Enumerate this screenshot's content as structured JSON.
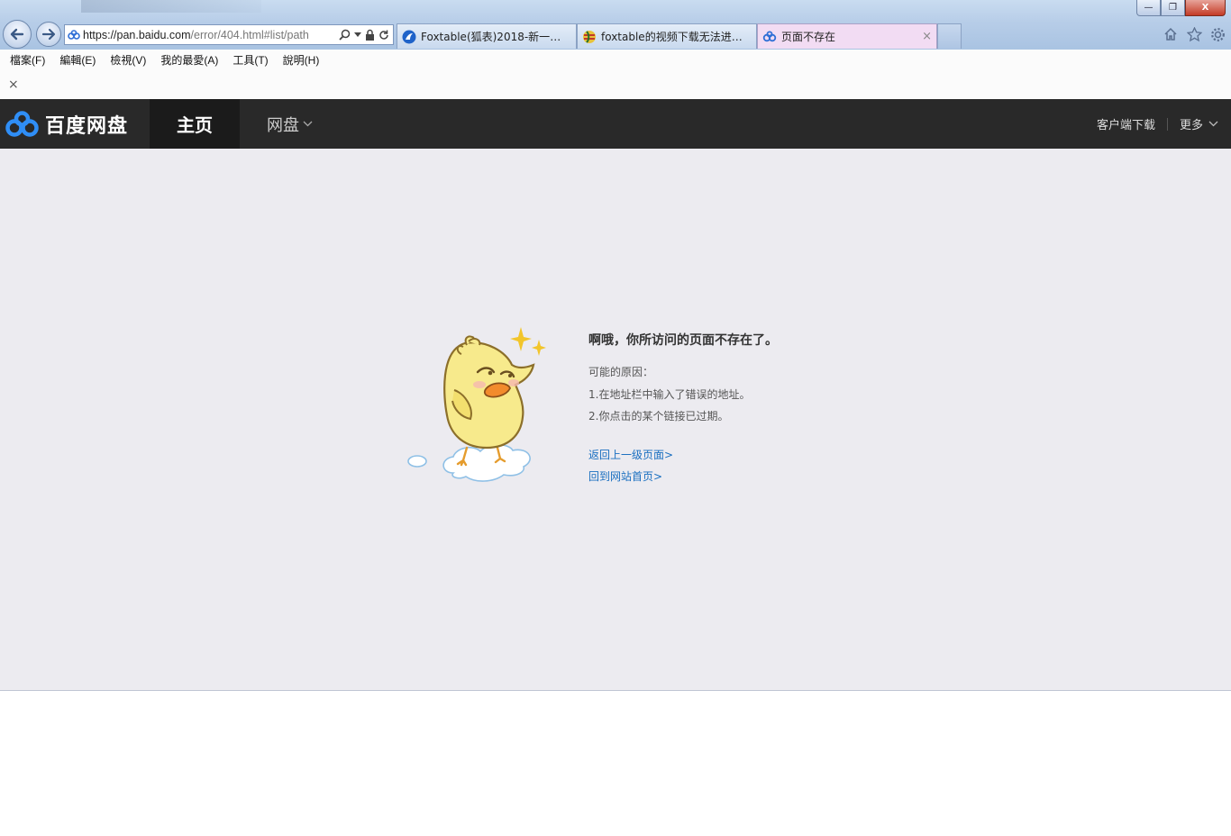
{
  "browser": {
    "address": {
      "url_main": "https://pan.baidu.com",
      "url_path": "/error/404.html#list/path"
    },
    "tabs": [
      {
        "label": "Foxtable(狐表)2018-新一代数...",
        "icon": "foxtable-icon",
        "active": false
      },
      {
        "label": "foxtable的视频下载无法进入...",
        "icon": "colorful-globe-icon",
        "active": false
      },
      {
        "label": "页面不存在",
        "icon": "baidu-pan-icon",
        "active": true,
        "close": "×"
      }
    ],
    "window_buttons": {
      "minimize": "—",
      "restore": "❐",
      "close": "X"
    },
    "menu": [
      "檔案(F)",
      "編輯(E)",
      "檢視(V)",
      "我的最愛(A)",
      "工具(T)",
      "說明(H)"
    ],
    "favbar_close": "×"
  },
  "site": {
    "logo_text": "百度网盘",
    "nav_home": "主页",
    "nav_pan": "网盘",
    "client_download": "客户端下载",
    "more": "更多"
  },
  "error": {
    "title": "啊哦，你所访问的页面不存在了。",
    "reason_heading": "可能的原因：",
    "reasons": [
      "1.在地址栏中输入了错误的地址。",
      "2.你点击的某个链接已过期。"
    ],
    "links": {
      "back": "返回上一级页面>",
      "home": "回到网站首页>"
    }
  },
  "colors": {
    "header_bg": "#292929",
    "content_bg": "#ecebf0",
    "link": "#1a6fc0",
    "logo_blue": "#2f8ef6"
  }
}
